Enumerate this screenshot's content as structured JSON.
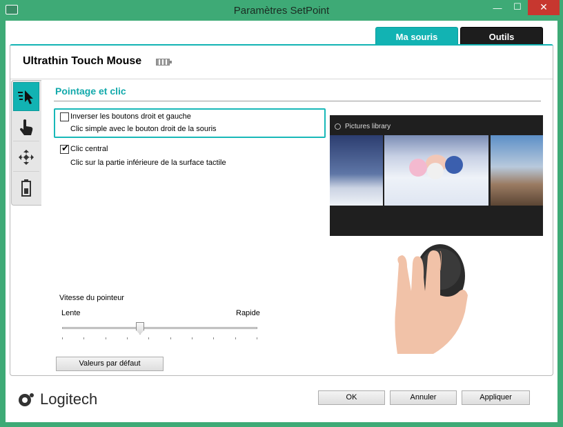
{
  "window": {
    "title": "Paramètres SetPoint",
    "minimize_glyph": "—",
    "maximize_glyph": "☐",
    "close_glyph": "✕"
  },
  "tabs": [
    {
      "label": "Ma souris",
      "active": true
    },
    {
      "label": "Outils",
      "active": false
    }
  ],
  "device": {
    "name": "Ultrathin Touch Mouse",
    "battery_icon": "battery-icon"
  },
  "side_nav": [
    {
      "icon": "pointer-click-icon",
      "active": true
    },
    {
      "icon": "hand-gesture-icon",
      "active": false
    },
    {
      "icon": "move-arrows-icon",
      "active": false
    },
    {
      "icon": "battery-icon",
      "active": false
    }
  ],
  "section": {
    "title": "Pointage et clic",
    "options": [
      {
        "label": "Inverser les boutons droit et gauche",
        "description": "Clic simple avec le bouton droit de la souris",
        "checked": false
      },
      {
        "label": "Clic central",
        "description": "Clic sur la partie inférieure de la surface tactile",
        "checked": true
      }
    ]
  },
  "speed": {
    "title": "Vitesse du pointeur",
    "min_label": "Lente",
    "max_label": "Rapide",
    "value_fraction": 0.4
  },
  "preview": {
    "library_title": "Pictures library"
  },
  "buttons": {
    "defaults": "Valeurs par défaut",
    "ok": "OK",
    "cancel": "Annuler",
    "apply": "Appliquer"
  },
  "logo": {
    "text": "Logitech"
  },
  "colors": {
    "accent": "#12b3b3",
    "frame": "#3eaa76",
    "close": "#c7372f"
  }
}
